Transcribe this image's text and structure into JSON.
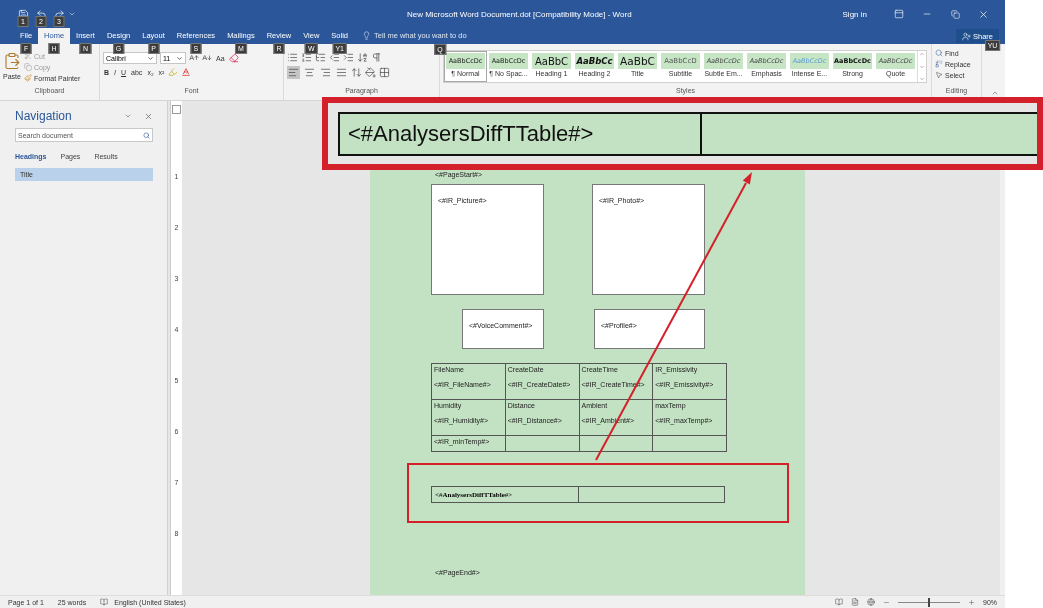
{
  "window": {
    "title": "New Microsoft Word Document.dot [Compatibility Mode] - Word",
    "sign_in": "Sign in"
  },
  "quick_access": [
    {
      "keytip": "1"
    },
    {
      "keytip": "2"
    },
    {
      "keytip": "3"
    }
  ],
  "tabs": [
    {
      "label": "File",
      "keytip": "F",
      "selected": false
    },
    {
      "label": "Home",
      "keytip": "H",
      "selected": true
    },
    {
      "label": "Insert",
      "keytip": "N",
      "selected": false
    },
    {
      "label": "Design",
      "keytip": "G",
      "selected": false
    },
    {
      "label": "Layout",
      "keytip": "P",
      "selected": false
    },
    {
      "label": "References",
      "keytip": "S",
      "selected": false
    },
    {
      "label": "Mailings",
      "keytip": "M",
      "selected": false
    },
    {
      "label": "Review",
      "keytip": "R",
      "selected": false
    },
    {
      "label": "View",
      "keytip": "W",
      "selected": false
    },
    {
      "label": "Solid",
      "keytip": "Y1",
      "selected": false
    }
  ],
  "tell_me": {
    "placeholder": "Tell me what you want to do",
    "keytip": "Q"
  },
  "share": {
    "label": "Share",
    "keytip": "YU"
  },
  "clipboard": {
    "label": "Clipboard",
    "paste": "Paste",
    "cut": "Cut",
    "copy": "Copy",
    "format_painter": "Format Painter"
  },
  "font": {
    "label": "Font",
    "name": "Calibri",
    "size": "11",
    "case": "Aa",
    "buttons": [
      "B",
      "I",
      "U",
      "abc",
      "x₂",
      "x²"
    ]
  },
  "paragraph": {
    "label": "Paragraph",
    "alignments": [
      {
        "selected": true
      },
      {
        "selected": false
      },
      {
        "selected": false
      },
      {
        "selected": false
      }
    ]
  },
  "styles": {
    "label": "Styles",
    "items": [
      {
        "kind": "normal",
        "preview": "AaBbCcDc",
        "label": "¶ Normal",
        "selected": true
      },
      {
        "kind": "normal",
        "preview": "AaBbCcDc",
        "label": "¶ No Spac...",
        "selected": false
      },
      {
        "kind": "heading1",
        "preview": "AaBbC",
        "label": "Heading 1",
        "selected": false
      },
      {
        "kind": "heading2",
        "preview": "AaBbCc",
        "label": "Heading 2",
        "selected": false
      },
      {
        "kind": "title",
        "preview": "AaBbC",
        "label": "Title",
        "selected": false
      },
      {
        "kind": "subtitle",
        "preview": "AaBbCcD",
        "label": "Subtitle",
        "selected": false
      },
      {
        "kind": "italic",
        "preview": "AaBbCcDc",
        "label": "Subtle Em...",
        "selected": false
      },
      {
        "kind": "italic",
        "preview": "AaBbCcDc",
        "label": "Emphasis",
        "selected": false
      },
      {
        "kind": "intense",
        "preview": "AaBbCcDc",
        "label": "Intense E...",
        "selected": false
      },
      {
        "kind": "strong",
        "preview": "AaBbCcDc",
        "label": "Strong",
        "selected": false
      },
      {
        "kind": "italic",
        "preview": "AaBbCcDc",
        "label": "Quote",
        "selected": false
      }
    ]
  },
  "editing": {
    "label": "Editing",
    "find": "Find",
    "replace": "Replace",
    "select": "Select"
  },
  "navigation": {
    "title": "Navigation",
    "search": {
      "placeholder": "Search document"
    },
    "tabs": [
      {
        "label": "Headings",
        "selected": true
      },
      {
        "label": "Pages",
        "selected": false
      },
      {
        "label": "Results",
        "selected": false
      }
    ],
    "headings": [
      {
        "label": "Title",
        "selected": true
      }
    ]
  },
  "vertical_ruler": [
    "1",
    "2",
    "3",
    "4",
    "5",
    "6",
    "7",
    "8"
  ],
  "document": {
    "page_start": "<#PageStart#>",
    "pictures": [
      "<#IR_Picture#>",
      "<#IR_Photo#>"
    ],
    "boxes": [
      "<#VoiceComment#>",
      "<#Profile#>"
    ],
    "info_table": {
      "rows": [
        {
          "cells": [
            [
              "FileName",
              "<#IR_FileName#>"
            ],
            [
              "CreateDate",
              "<#IR_CreateDate#>"
            ],
            [
              "CreateTime",
              "<#IR_CreateTime#>"
            ],
            [
              "IR_Emissivity",
              "<#IR_Emissivity#>"
            ]
          ]
        },
        {
          "cells": [
            [
              "Humidity",
              "<#IR_Humidity#>"
            ],
            [
              "Distance",
              "<#IR_Distance#>"
            ],
            [
              "Ambient",
              "<#IR_Ambient#>"
            ],
            [
              "maxTemp",
              "<#IR_maxTemp#>"
            ]
          ]
        },
        {
          "cells": [
            [
              "<#IR_minTemp#>"
            ]
          ]
        }
      ]
    },
    "diff_table": "<#**AnalysersDiffTTable**#>",
    "page_end": "<#PageEnd#>"
  },
  "callout": {
    "text": "<#AnalysersDiffTTable#>"
  },
  "status_bar": {
    "page": "Page 1 of 1",
    "words": "25 words",
    "language": "English (United States)",
    "zoom": "90%",
    "zoom_slider": {
      "level": 0.5
    }
  }
}
